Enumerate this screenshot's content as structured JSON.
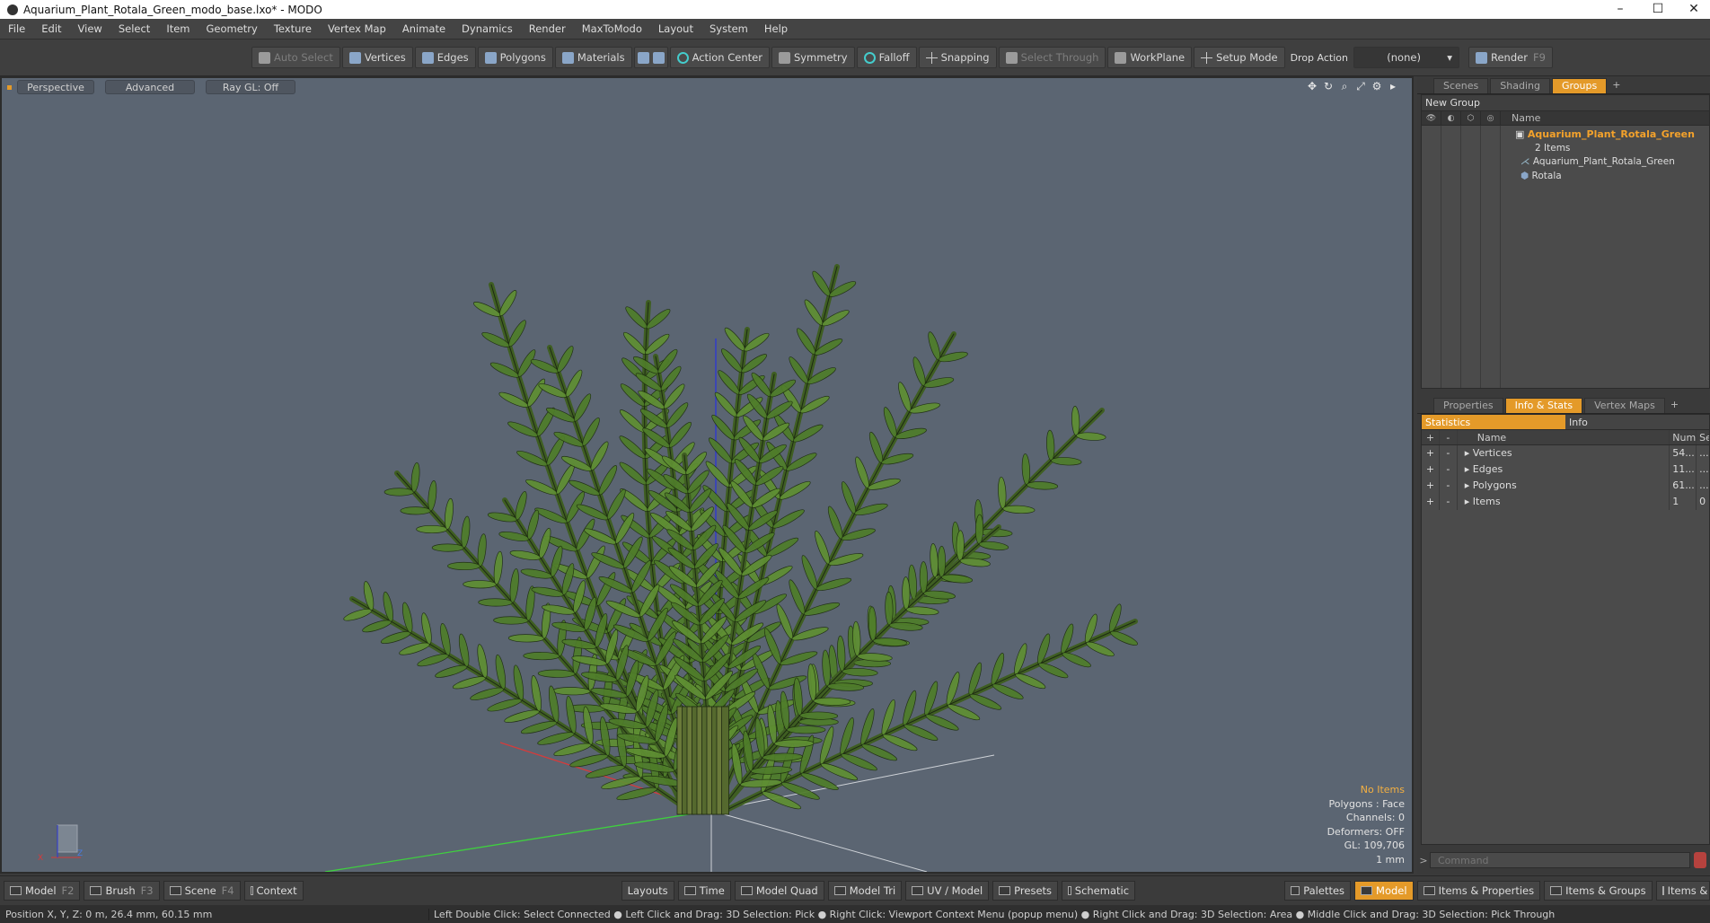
{
  "window": {
    "title": "Aquarium_Plant_Rotala_Green_modo_base.lxo* - MODO",
    "controls": [
      "–",
      "☐",
      "✕"
    ]
  },
  "menu": [
    "File",
    "Edit",
    "View",
    "Select",
    "Item",
    "Geometry",
    "Texture",
    "Vertex Map",
    "Animate",
    "Dynamics",
    "Render",
    "MaxToModo",
    "Layout",
    "System",
    "Help"
  ],
  "toolbar": {
    "auto_select": "Auto Select",
    "vertices": "Vertices",
    "edges": "Edges",
    "polygons": "Polygons",
    "materials": "Materials",
    "action_center": "Action Center",
    "symmetry": "Symmetry",
    "falloff": "Falloff",
    "snapping": "Snapping",
    "select_through": "Select Through",
    "workplane": "WorkPlane",
    "setup_mode": "Setup Mode",
    "drop_action": "Drop Action",
    "drop_value": "(none)",
    "render": "Render",
    "render_key": "F9"
  },
  "viewport": {
    "tabs": [
      "Perspective",
      "Advanced",
      "Ray GL: Off"
    ],
    "hud": {
      "no_items": "No Items",
      "polygons": "Polygons : Face",
      "channels": "Channels: 0",
      "deformers": "Deformers: OFF",
      "gl": "GL: 109,706",
      "scale": "1 mm"
    },
    "axis_x": "X",
    "axis_z": "Z"
  },
  "groups_panel": {
    "tabs": [
      "Scenes",
      "Shading",
      "Groups",
      "+"
    ],
    "new_group": "New Group",
    "col_name": "Name",
    "group_name": "Aquarium_Plant_Rotala_Green",
    "group_count": "2 Items",
    "children": [
      "Aquarium_Plant_Rotala_Green",
      "Rotala"
    ]
  },
  "stats_panel": {
    "tabs": [
      "Properties",
      "Info & Stats",
      "Vertex Maps",
      "+"
    ],
    "subtabs": [
      "Statistics",
      "Info"
    ],
    "headers": {
      "plus": "+",
      "minus": "-",
      "name": "Name",
      "num": "Num",
      "sel": "Sel"
    },
    "rows": [
      {
        "name": "Vertices",
        "num": "54...",
        "sel": "..."
      },
      {
        "name": "Edges",
        "num": "11...",
        "sel": "..."
      },
      {
        "name": "Polygons",
        "num": "61...",
        "sel": "..."
      },
      {
        "name": "Items",
        "num": "1",
        "sel": "0"
      }
    ]
  },
  "command": {
    "placeholder": "Command"
  },
  "bottombar": {
    "left": [
      {
        "label": "Model",
        "key": "F2"
      },
      {
        "label": "Brush",
        "key": "F3"
      },
      {
        "label": "Scene",
        "key": "F4"
      },
      {
        "label": "Context",
        "key": ""
      }
    ],
    "center": [
      "Layouts",
      "Time",
      "Model Quad",
      "Model Tri",
      "UV / Model",
      "Presets",
      "Schematic"
    ],
    "palettes": "Palettes",
    "model": "Model",
    "right": [
      "Items & Properties",
      "Items & Groups",
      "Items & Shading"
    ]
  },
  "statusbar": {
    "position": "Position X, Y, Z:   0 m, 26.4 mm, 60.15 mm",
    "hints": "Left Double Click: Select Connected ● Left Click and Drag: 3D Selection: Pick ● Right Click: Viewport Context Menu (popup menu) ● Right Click and Drag: 3D Selection: Area ● Middle Click and Drag: 3D Selection: Pick Through"
  },
  "colors": {
    "accent": "#e49a29",
    "viewport_bg": "#5b6572",
    "leaf": "#4f7d2a"
  }
}
